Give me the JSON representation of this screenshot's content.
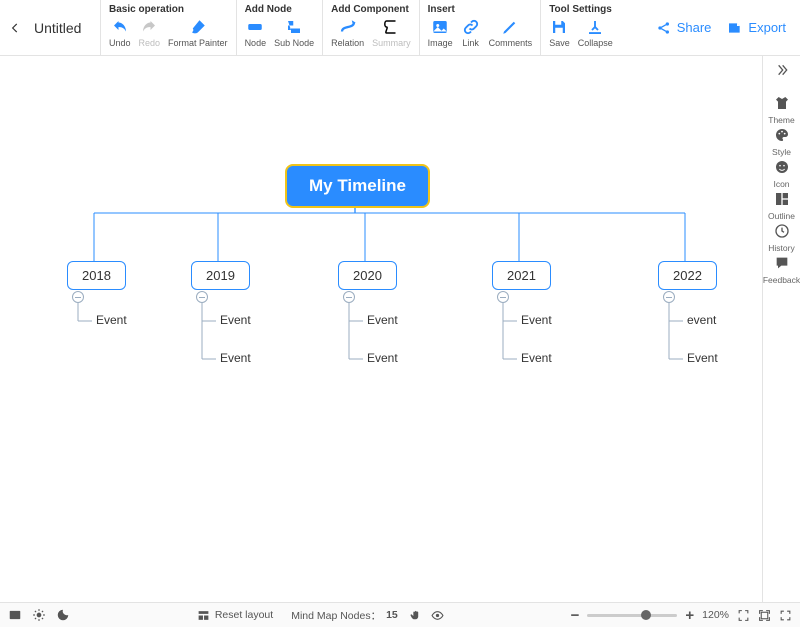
{
  "doc": {
    "title": "Untitled"
  },
  "toolbar": {
    "groups": [
      {
        "title": "Basic operation",
        "items": [
          {
            "id": "undo",
            "label": "Undo",
            "icon": "undo"
          },
          {
            "id": "redo",
            "label": "Redo",
            "icon": "redo",
            "disabled": true
          },
          {
            "id": "format",
            "label": "Format Painter",
            "icon": "brush"
          }
        ]
      },
      {
        "title": "Add Node",
        "items": [
          {
            "id": "node-btn",
            "label": "Node",
            "icon": "node"
          },
          {
            "id": "subnode",
            "label": "Sub Node",
            "icon": "subnode"
          }
        ]
      },
      {
        "title": "Add Component",
        "items": [
          {
            "id": "relation",
            "label": "Relation",
            "icon": "relation"
          },
          {
            "id": "summary",
            "label": "Summary",
            "icon": "summary",
            "disabled": true
          }
        ]
      },
      {
        "title": "Insert",
        "items": [
          {
            "id": "image",
            "label": "Image",
            "icon": "image"
          },
          {
            "id": "link",
            "label": "Link",
            "icon": "link"
          },
          {
            "id": "comments",
            "label": "Comments",
            "icon": "pen"
          }
        ]
      },
      {
        "title": "Tool Settings",
        "items": [
          {
            "id": "save",
            "label": "Save",
            "icon": "save"
          },
          {
            "id": "collapse",
            "label": "Collapse",
            "icon": "collapse"
          }
        ]
      }
    ],
    "share": "Share",
    "export": "Export"
  },
  "rail": [
    {
      "id": "theme",
      "label": "Theme",
      "icon": "shirt"
    },
    {
      "id": "style",
      "label": "Style",
      "icon": "palette"
    },
    {
      "id": "icon",
      "label": "Icon",
      "icon": "smile"
    },
    {
      "id": "outline",
      "label": "Outline",
      "icon": "grid"
    },
    {
      "id": "history",
      "label": "History",
      "icon": "clock"
    },
    {
      "id": "feedback",
      "label": "Feedback",
      "icon": "chat"
    }
  ],
  "mindmap": {
    "root": "My Timeline",
    "years": [
      "2018",
      "2019",
      "2020",
      "2021",
      "2022"
    ],
    "leaves": {
      "0": [
        "Event"
      ],
      "1": [
        "Event",
        "Event"
      ],
      "2": [
        "Event",
        "Event"
      ],
      "3": [
        "Event",
        "Event"
      ],
      "4": [
        "event",
        "Event"
      ]
    }
  },
  "bottom": {
    "reset": "Reset layout",
    "nodes_label": "Mind Map Nodes：",
    "nodes_count": "15",
    "zoom": "120%"
  }
}
